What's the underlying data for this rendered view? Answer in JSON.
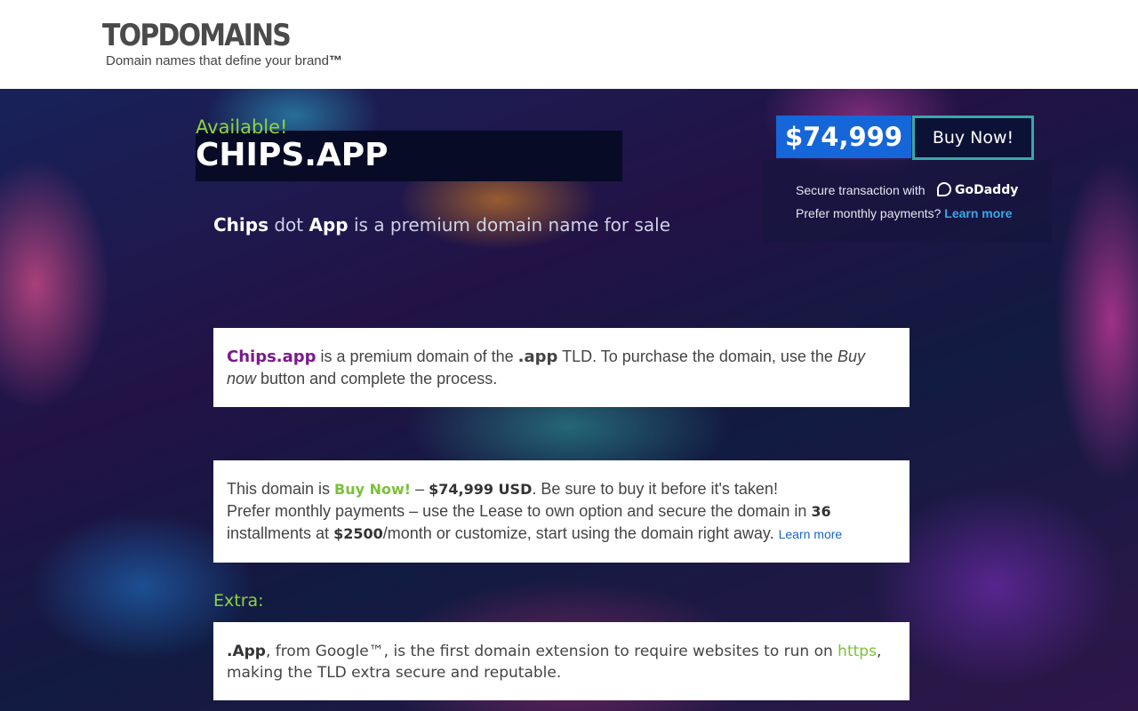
{
  "header": {
    "logo": "TOPDOMAINS",
    "tagline": "Domain names that define your brand",
    "tagline_tm": "™"
  },
  "hero": {
    "available": "Available!",
    "domain": "CHIPS.APP",
    "subtitle_part1": "Chips",
    "subtitle_part2": " dot ",
    "subtitle_part3": "App",
    "subtitle_part4": " is a premium domain name for sale"
  },
  "purchase": {
    "price": "$74,999",
    "buy_label": "Buy Now!",
    "secure_text": "Secure transaction with",
    "brand": "GoDaddy",
    "monthly_text": "Prefer monthly payments?",
    "learn_more": "Learn more"
  },
  "card1": {
    "name": "Chips.app",
    "t1": " is a premium domain of the ",
    "tld": ".app",
    "t2": " TLD. To purchase the domain, use the ",
    "buy_now_italic": "Buy now",
    "t3": " button and complete the process."
  },
  "card2": {
    "t1": "This domain is ",
    "buy_now": "Buy Now!",
    "t2": " – ",
    "price_usd": "$74,999 USD",
    "t3": ". Be sure to buy it before it's taken!",
    "t4": "Prefer monthly payments – use the Lease to own option and secure the domain in ",
    "installments": "36",
    "t5": " installments at ",
    "monthly_price": "$2500",
    "t6": "/month or customize, start using the domain right away. ",
    "learn_more": "Learn more"
  },
  "extra": {
    "label": "Extra:",
    "app": ".App",
    "t1": ", from Google™, is the first domain extension to require websites to run on ",
    "https": "https",
    "t2": ", making the TLD extra secure and reputable."
  },
  "colors": {
    "accent_green": "#8ed43c",
    "price_blue": "#1566d8",
    "domain_purple": "#7a1a8c",
    "link_blue": "#3aa7e8"
  }
}
